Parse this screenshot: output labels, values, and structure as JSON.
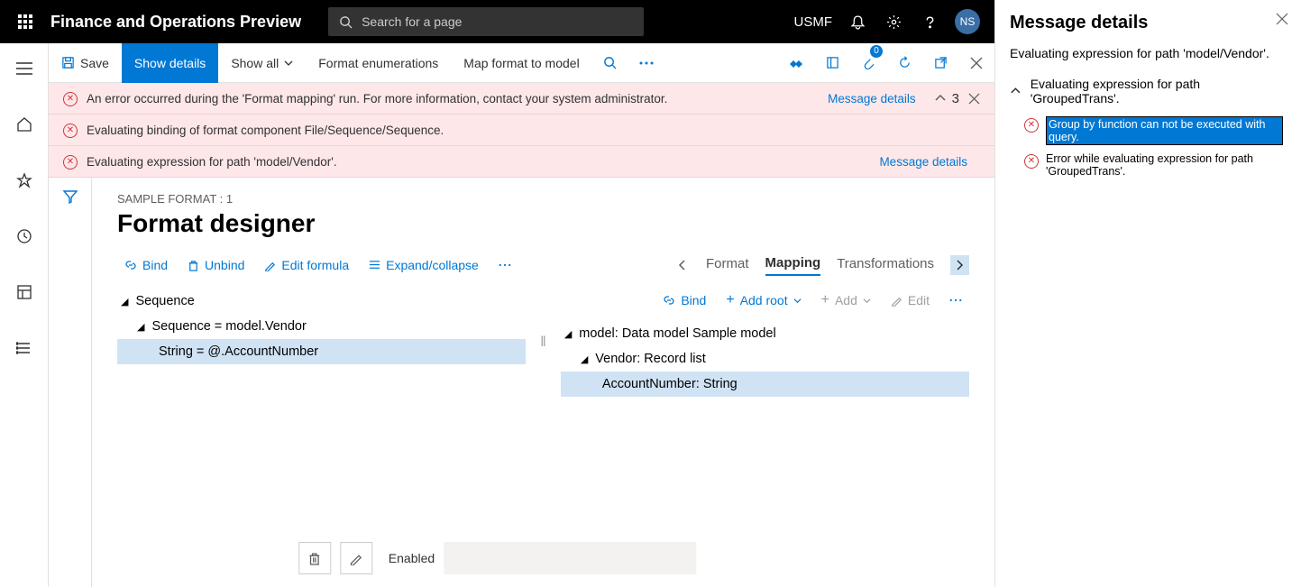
{
  "topbar": {
    "app_title": "Finance and Operations Preview",
    "search_placeholder": "Search for a page",
    "entity": "USMF",
    "avatar_initials": "NS"
  },
  "actionbar": {
    "save": "Save",
    "show_details": "Show details",
    "show_all": "Show all",
    "format_enum": "Format enumerations",
    "map_format": "Map format to model",
    "attachment_count": "0"
  },
  "errors": {
    "err1": "An error occurred during the 'Format mapping' run. For more information, contact your system administrator.",
    "err2": "Evaluating binding of format component File/Sequence/Sequence.",
    "err3": "Evaluating expression for path 'model/Vendor'.",
    "details_link": "Message details",
    "count": "3"
  },
  "breadcrumb": "SAMPLE FORMAT : 1",
  "page_title": "Format designer",
  "toolbar": {
    "bind": "Bind",
    "unbind": "Unbind",
    "edit_formula": "Edit formula",
    "expand": "Expand/collapse",
    "bind2": "Bind",
    "add_root": "Add root",
    "add": "Add",
    "edit": "Edit"
  },
  "tabs": {
    "format": "Format",
    "mapping": "Mapping",
    "transformations": "Transformations"
  },
  "left_tree": {
    "n1": "Sequence",
    "n2": "Sequence = model.Vendor",
    "n3": "String = @.AccountNumber"
  },
  "right_tree": {
    "n1": "model: Data model Sample model",
    "n2": "Vendor: Record list",
    "n3": "AccountNumber: String"
  },
  "bottom": {
    "enabled": "Enabled"
  },
  "sidepanel": {
    "title": "Message details",
    "eval": "Evaluating expression for path 'model/Vendor'.",
    "group_header": "Evaluating expression for path 'GroupedTrans'.",
    "msg1": "Group by function can not be executed with query.",
    "msg2": "Error while evaluating expression for path 'GroupedTrans'."
  }
}
